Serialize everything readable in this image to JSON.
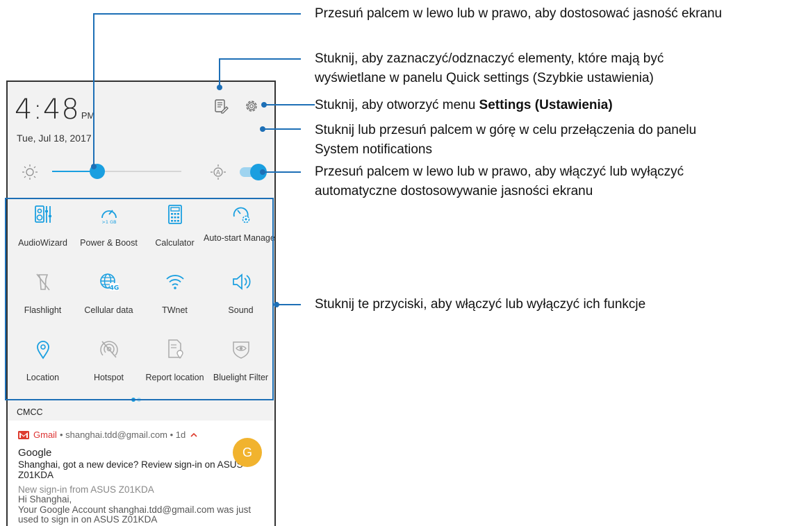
{
  "status": {
    "time": "4:48",
    "ampm": "PM",
    "date": "Tue, Jul 18, 2017"
  },
  "brightness": {
    "level_fraction": 0.35,
    "auto_enabled": true
  },
  "tiles": [
    {
      "label": "AudioWizard",
      "icon": "audiowizard-icon"
    },
    {
      "label": "Power & Boost",
      "icon": "power-boost-icon",
      "badge": ">1 GB"
    },
    {
      "label": "Calculator",
      "icon": "calculator-icon"
    },
    {
      "label": "Auto-start Manager",
      "icon": "auto-start-manager-icon"
    },
    {
      "label": "Flashlight",
      "icon": "flashlight-icon"
    },
    {
      "label": "Cellular data",
      "icon": "cellular-data-icon",
      "badge": "4G"
    },
    {
      "label": "TWnet",
      "icon": "wifi-icon"
    },
    {
      "label": "Sound",
      "icon": "sound-icon"
    },
    {
      "label": "Location",
      "icon": "location-icon"
    },
    {
      "label": "Hotspot",
      "icon": "hotspot-icon"
    },
    {
      "label": "Report location",
      "icon": "report-location-icon"
    },
    {
      "label": "Bluelight Filter",
      "icon": "bluelight-filter-icon"
    }
  ],
  "carrier": "CMCC",
  "notification": {
    "app": "Gmail",
    "account": "• shanghai.tdd@gmail.com • 1d",
    "title": "Google",
    "body": "Shanghai, got a new device? Review sign-in on ASUS Z01KDA",
    "subtitle": "New sign-in from ASUS Z01KDA",
    "greeting": "Hi Shanghai,",
    "text": "Your Google Account shanghai.tdd@gmail.com was just used to sign in on ASUS Z01KDA",
    "avatar_letter": "G"
  },
  "callouts": {
    "brightness": "Przesuń palcem w lewo lub w prawo, aby dostosować jasność ekranu",
    "edit_line1": "Stuknij, aby zaznaczyć/odznaczyć elementy, które mają być",
    "edit_line2": "wyświetlane w panelu Quick settings (Szybkie ustawienia)",
    "settings_prefix": "Stuknij, aby otworzyć menu ",
    "settings_bold": "Settings (Ustawienia)",
    "system_line1": "Stuknij lub przesuń palcem w górę w celu przełączenia do panelu",
    "system_line2": "System notifications",
    "auto_line1": "Przesuń palcem w lewo lub w prawo, aby włączyć lub wyłączyć",
    "auto_line2": "automatyczne dostosowywanie jasności ekranu",
    "tiles": "Stuknij te przyciski, aby włączyć lub wyłączyć ich funkcje"
  },
  "colors": {
    "accent": "#1a9fe0",
    "annotation": "#1d6fb6",
    "gmail": "#dd3b2e",
    "avatar": "#f1b32e"
  }
}
